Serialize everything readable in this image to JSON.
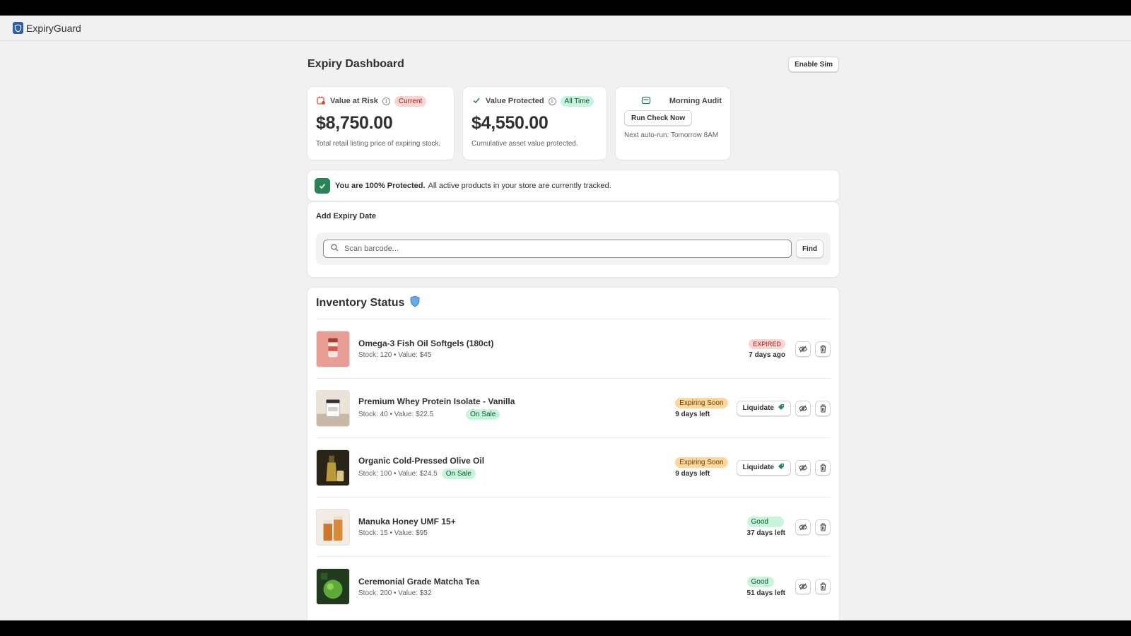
{
  "app": {
    "name": "ExpiryGuard"
  },
  "header": {
    "title": "Expiry Dashboard",
    "enable_sim_label": "Enable Sim"
  },
  "kpis": {
    "risk": {
      "label": "Value at Risk",
      "badge": "Current",
      "value": "$8,750.00",
      "note": "Total retail listing price of expiring stock."
    },
    "protected": {
      "label": "Value Protected",
      "badge": "All Time",
      "value": "$4,550.00",
      "note": "Cumulative asset value protected."
    },
    "audit": {
      "label": "Morning Audit",
      "button": "Run Check Now",
      "note": "Next auto-run: Tomorrow 8AM"
    }
  },
  "banner": {
    "bold": "You are 100% Protected.",
    "text": "All active products in your store are currently tracked."
  },
  "add_expiry": {
    "title": "Add Expiry Date",
    "placeholder": "Scan barcode...",
    "find_label": "Find"
  },
  "inventory": {
    "title": "Inventory Status",
    "liquidate_label": "Liquidate",
    "items": [
      {
        "name": "Omega-3 Fish Oil Softgels (180ct)",
        "meta": "Stock: 120 • Value: $45",
        "sale": "",
        "status": "EXPIRED",
        "days": "7 days ago"
      },
      {
        "name": "Premium Whey Protein Isolate - Vanilla",
        "meta": "Stock: 40 • Value: $22.5",
        "sale": "On Sale",
        "status": "Expiring Soon",
        "days": "9 days left"
      },
      {
        "name": "Organic Cold-Pressed Olive Oil",
        "meta": "Stock: 100 • Value: $24.5",
        "sale": "On Sale",
        "status": "Expiring Soon",
        "days": "9 days left"
      },
      {
        "name": "Manuka Honey UMF 15+",
        "meta": "Stock: 15 • Value: $95",
        "sale": "",
        "status": "Good",
        "days": "37 days left"
      },
      {
        "name": "Ceremonial Grade Matcha Tea",
        "meta": "Stock: 200 • Value: $32",
        "sale": "",
        "status": "Good",
        "days": "51 days left"
      }
    ]
  },
  "colors": {
    "brand": "#2c5fa3",
    "success": "#29845a",
    "critical_bg": "#fed3d1",
    "warning_bg": "#ffd79d",
    "good_bg": "#c9f4dc"
  }
}
